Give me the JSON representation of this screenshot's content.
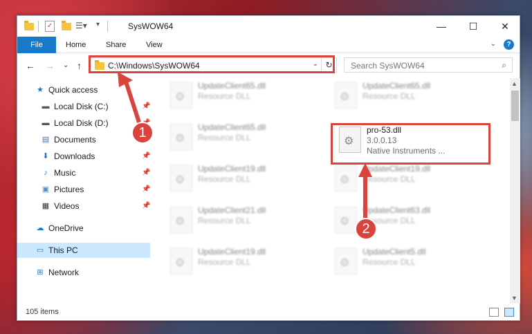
{
  "window": {
    "title": "SysWOW64"
  },
  "title_controls": {
    "minimize": "—",
    "maximize": "☐",
    "close": "✕"
  },
  "ribbon": {
    "tabs": [
      "File",
      "Home",
      "Share",
      "View"
    ],
    "expand": "⌄",
    "help": "?"
  },
  "nav": {
    "back": "←",
    "forward": "→",
    "recent": "⌄",
    "up": "↑",
    "address": "C:\\Windows\\SysWOW64",
    "address_dropdown": "⌄",
    "refresh": "↻",
    "search_placeholder": "Search SysWOW64",
    "search_icon": "⌕"
  },
  "sidebar": {
    "items": [
      {
        "label": "Quick access",
        "icon": "star-icon",
        "glyph": "★",
        "color": "#1979ca",
        "pinned": false
      },
      {
        "label": "Local Disk (C:)",
        "icon": "drive-icon",
        "glyph": "▬",
        "color": "#555",
        "pinned": true
      },
      {
        "label": "Local Disk (D:)",
        "icon": "drive-icon",
        "glyph": "▬",
        "color": "#555",
        "pinned": true
      },
      {
        "label": "Documents",
        "icon": "documents-icon",
        "glyph": "▤",
        "color": "#4a6fa5",
        "pinned": true
      },
      {
        "label": "Downloads",
        "icon": "download-icon",
        "glyph": "⬇",
        "color": "#1979ca",
        "pinned": true
      },
      {
        "label": "Music",
        "icon": "music-icon",
        "glyph": "♪",
        "color": "#1979ca",
        "pinned": true
      },
      {
        "label": "Pictures",
        "icon": "pictures-icon",
        "glyph": "▣",
        "color": "#4a8fc9",
        "pinned": true
      },
      {
        "label": "Videos",
        "icon": "videos-icon",
        "glyph": "▦",
        "color": "#333",
        "pinned": true
      },
      {
        "label": "OneDrive",
        "icon": "cloud-icon",
        "glyph": "☁",
        "color": "#1979ca",
        "pinned": false
      },
      {
        "label": "This PC",
        "icon": "computer-icon",
        "glyph": "▭",
        "color": "#1979ca",
        "pinned": false
      },
      {
        "label": "Network",
        "icon": "network-icon",
        "glyph": "⊞",
        "color": "#1979ca",
        "pinned": false
      }
    ],
    "pin_glyph": "📌"
  },
  "files": [
    {
      "name": "UpdateClient65.dll",
      "sub": "Resource DLL",
      "blurred": true
    },
    {
      "name": "UpdateClient65.dll",
      "sub": "Resource DLL",
      "blurred": true
    },
    {
      "name": "UpdateClient65.dll",
      "sub": "Resource DLL",
      "blurred": true
    },
    {
      "name": "pro-53.dll",
      "sub": "3.0.0.13",
      "sub2": "Native Instruments ...",
      "blurred": false
    },
    {
      "name": "UpdateClient19.dll",
      "sub": "Resource DLL",
      "blurred": true
    },
    {
      "name": "UpdateClient19.dll",
      "sub": "Resource DLL",
      "blurred": true
    },
    {
      "name": "UpdateClient21.dll",
      "sub": "Resource DLL",
      "blurred": true
    },
    {
      "name": "UpdateClient63.dll",
      "sub": "Resource DLL",
      "blurred": true
    },
    {
      "name": "UpdateClient19.dll",
      "sub": "Resource DLL",
      "blurred": true
    },
    {
      "name": "UpdateClient5.dll",
      "sub": "Resource DLL",
      "blurred": true
    }
  ],
  "status": {
    "item_count": "105 items"
  },
  "annotations": {
    "step1": "1",
    "step2": "2",
    "color": "#d9453d"
  }
}
